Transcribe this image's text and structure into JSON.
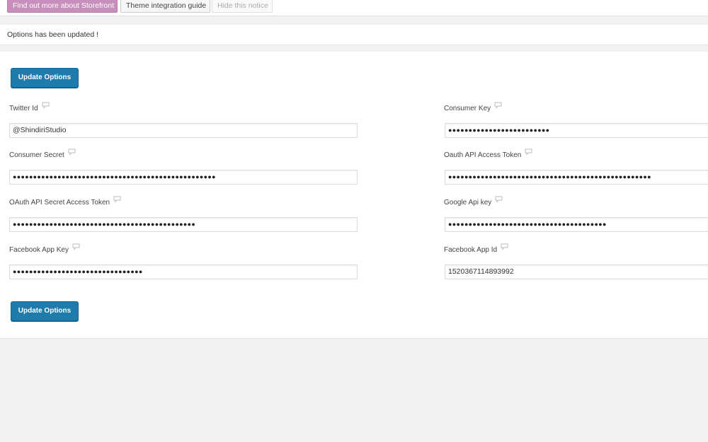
{
  "notice": {
    "learn_more": "Find out more about Storefront",
    "integration": "Theme integration guide",
    "hide": "Hide this notice"
  },
  "updated_message": "Options has been updated !",
  "form": {
    "update_label": "Update Options",
    "twitter_id": {
      "label": "Twitter Id",
      "value": "@ShindiriStudio"
    },
    "consumer_key": {
      "label": "Consumer Key",
      "value": "●●●●●●●●●●●●●●●●●●●●●●●●●"
    },
    "consumer_secret": {
      "label": "Consumer Secret",
      "value": "●●●●●●●●●●●●●●●●●●●●●●●●●●●●●●●●●●●●●●●●●●●●●●●●●●"
    },
    "oauth_access_token": {
      "label": "Oauth API Access Token",
      "value": "●●●●●●●●●●●●●●●●●●●●●●●●●●●●●●●●●●●●●●●●●●●●●●●●●●"
    },
    "oauth_secret_token": {
      "label": "OAuth API Secret Access Token",
      "value": "●●●●●●●●●●●●●●●●●●●●●●●●●●●●●●●●●●●●●●●●●●●●●"
    },
    "google_api_key": {
      "label": "Google Api key",
      "value": "●●●●●●●●●●●●●●●●●●●●●●●●●●●●●●●●●●●●●●●"
    },
    "facebook_app_key": {
      "label": "Facebook App Key",
      "value": "●●●●●●●●●●●●●●●●●●●●●●●●●●●●●●●●"
    },
    "facebook_app_id": {
      "label": "Facebook App Id",
      "value": "1520367114893992"
    }
  },
  "icons": {
    "tooltip": "speech-bubble-icon"
  },
  "colors": {
    "primary_button": "#1e7bac",
    "storefront_button": "#c88fbd"
  }
}
